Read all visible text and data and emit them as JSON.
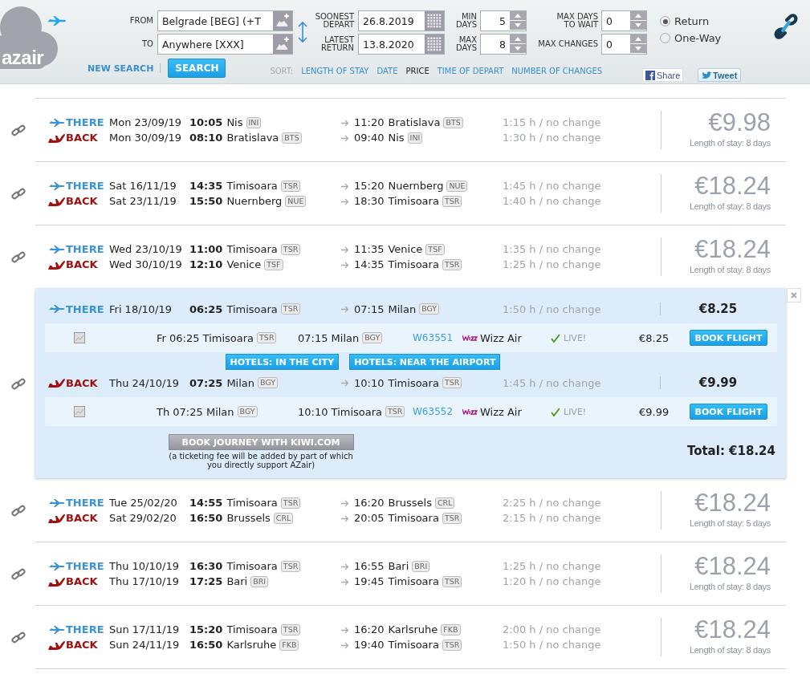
{
  "logo": {
    "text": "azair"
  },
  "search_form": {
    "from": {
      "label": "FROM",
      "value": "Belgrade [BEG] (+T"
    },
    "to": {
      "label": "TO",
      "value": "Anywhere [XXX]"
    },
    "soonest_depart": {
      "label": "SOONEST DEPART",
      "value": "26.8.2019"
    },
    "latest_return": {
      "label": "LATEST RETURN",
      "value": "13.8.2020"
    },
    "min_days": {
      "label": "MIN DAYS",
      "value": "5"
    },
    "max_days": {
      "label": "MAX DAYS",
      "value": "8"
    },
    "max_days_to_wait": {
      "label": "MAX DAYS TO WAIT",
      "value": "0"
    },
    "max_changes": {
      "label": "MAX CHANGES",
      "value": "0"
    },
    "trip_type": [
      {
        "label": "Return",
        "selected": true
      },
      {
        "label": "One-Way",
        "selected": false
      }
    ]
  },
  "actions": {
    "new_search": "NEW SEARCH",
    "search": "SEARCH"
  },
  "sort": {
    "label": "SORT:",
    "options": [
      {
        "label": "LENGTH OF STAY",
        "selected": false
      },
      {
        "label": "DATE",
        "selected": false
      },
      {
        "label": "PRICE",
        "selected": true
      },
      {
        "label": "TIME OF DEPART",
        "selected": false
      },
      {
        "label": "NUMBER OF CHANGES",
        "selected": false
      }
    ]
  },
  "social": {
    "share": "Share",
    "tweet": "Tweet"
  },
  "results": [
    {
      "kind": "summary",
      "price": "€9.98",
      "stay": "Length of stay: 8 days",
      "legs": [
        {
          "kind": "there",
          "label": "THERE",
          "date": "Mon 23/09/19",
          "time": "10:05",
          "city": "Nis",
          "code": "INI",
          "arrival_time": "11:20",
          "arrival_city": "Bratislava",
          "arrival_code": "BTS",
          "duration": "1:15 h / no change"
        },
        {
          "kind": "back",
          "label": "BACK",
          "date": "Mon 30/09/19",
          "time": "08:10",
          "city": "Bratislava",
          "code": "BTS",
          "arrival_time": "09:40",
          "arrival_city": "Nis",
          "arrival_code": "INI",
          "duration": "1:30 h / no change"
        }
      ]
    },
    {
      "kind": "summary",
      "price": "€18.24",
      "stay": "Length of stay: 8 days",
      "legs": [
        {
          "kind": "there",
          "label": "THERE",
          "date": "Sat 16/11/19",
          "time": "14:35",
          "city": "Timisoara",
          "code": "TSR",
          "arrival_time": "15:20",
          "arrival_city": "Nuernberg",
          "arrival_code": "NUE",
          "duration": "1:45 h / no change"
        },
        {
          "kind": "back",
          "label": "BACK",
          "date": "Sat 23/11/19",
          "time": "15:50",
          "city": "Nuernberg",
          "code": "NUE",
          "arrival_time": "18:30",
          "arrival_city": "Timisoara",
          "arrival_code": "TSR",
          "duration": "1:40 h / no change"
        }
      ]
    },
    {
      "kind": "summary",
      "price": "€18.24",
      "stay": "Length of stay: 8 days",
      "legs": [
        {
          "kind": "there",
          "label": "THERE",
          "date": "Wed 23/10/19",
          "time": "11:00",
          "city": "Timisoara",
          "code": "TSR",
          "arrival_time": "11:35",
          "arrival_city": "Venice",
          "arrival_code": "TSF",
          "duration": "1:35 h / no change"
        },
        {
          "kind": "back",
          "label": "BACK",
          "date": "Wed 30/10/19",
          "time": "12:10",
          "city": "Venice",
          "code": "TSF",
          "arrival_time": "14:35",
          "arrival_city": "Timisoara",
          "arrival_code": "TSR",
          "duration": "1:25 h / no change"
        }
      ]
    },
    {
      "kind": "detail",
      "hotels": [
        "HOTELS: IN THE CITY",
        "HOTELS: NEAR THE AIRPORT"
      ],
      "kiwi_button": "BOOK JOURNEY WITH KIWI.COM",
      "fee_note": "(a ticketing fee will be added by part of which you directly support AZair)",
      "total": "Total: €18.24",
      "legs": [
        {
          "kind": "there",
          "label": "THERE",
          "date": "Fri 18/10/19",
          "time": "06:25",
          "city": "Timisoara",
          "code": "TSR",
          "arrival_time": "07:15",
          "arrival_city": "Milan",
          "arrival_code": "BGY",
          "duration": "1:50 h / no change",
          "price": "€8.25",
          "segment": {
            "departure": "Fr 06:25 Timisoara",
            "departure_code": "TSR",
            "arrival": "07:15 Milan",
            "arrival_code": "BGY",
            "flight": "W63551",
            "airline": "Wizz Air",
            "status": "LIVE!",
            "price": "€8.25",
            "button": "BOOK FLIGHT"
          }
        },
        {
          "kind": "back",
          "label": "BACK",
          "date": "Thu 24/10/19",
          "time": "07:25",
          "city": "Milan",
          "code": "BGY",
          "arrival_time": "10:10",
          "arrival_city": "Timisoara",
          "arrival_code": "TSR",
          "duration": "1:45 h / no change",
          "price": "€9.99",
          "segment": {
            "departure": "Th 07:25 Milan",
            "departure_code": "BGY",
            "arrival": "10:10 Timisoara",
            "arrival_code": "TSR",
            "flight": "W63552",
            "airline": "Wizz Air",
            "status": "LIVE!",
            "price": "€9.99",
            "button": "BOOK FLIGHT"
          }
        }
      ]
    },
    {
      "kind": "summary",
      "price": "€18.24",
      "stay": "Length of stay: 5 days",
      "legs": [
        {
          "kind": "there",
          "label": "THERE",
          "date": "Tue 25/02/20",
          "time": "14:55",
          "city": "Timisoara",
          "code": "TSR",
          "arrival_time": "16:20",
          "arrival_city": "Brussels",
          "arrival_code": "CRL",
          "duration": "2:25 h / no change"
        },
        {
          "kind": "back",
          "label": "BACK",
          "date": "Sat 29/02/20",
          "time": "16:50",
          "city": "Brussels",
          "code": "CRL",
          "arrival_time": "20:05",
          "arrival_city": "Timisoara",
          "arrival_code": "TSR",
          "duration": "2:15 h / no change"
        }
      ]
    },
    {
      "kind": "summary",
      "price": "€18.24",
      "stay": "Length of stay: 8 days",
      "legs": [
        {
          "kind": "there",
          "label": "THERE",
          "date": "Thu 10/10/19",
          "time": "16:30",
          "city": "Timisoara",
          "code": "TSR",
          "arrival_time": "16:55",
          "arrival_city": "Bari",
          "arrival_code": "BRI",
          "duration": "1:25 h / no change"
        },
        {
          "kind": "back",
          "label": "BACK",
          "date": "Thu 17/10/19",
          "time": "17:25",
          "city": "Bari",
          "code": "BRI",
          "arrival_time": "19:45",
          "arrival_city": "Timisoara",
          "arrival_code": "TSR",
          "duration": "1:20 h / no change"
        }
      ]
    },
    {
      "kind": "summary",
      "price": "€18.24",
      "stay": "Length of stay: 8 days",
      "legs": [
        {
          "kind": "there",
          "label": "THERE",
          "date": "Sun 17/11/19",
          "time": "15:20",
          "city": "Timisoara",
          "code": "TSR",
          "arrival_time": "16:20",
          "arrival_city": "Karlsruhe",
          "arrival_code": "FKB",
          "duration": "2:00 h / no change"
        },
        {
          "kind": "back",
          "label": "BACK",
          "date": "Sun 24/11/19",
          "time": "16:50",
          "city": "Karlsruhe",
          "code": "FKB",
          "arrival_time": "19:40",
          "arrival_city": "Timisoara",
          "arrival_code": "TSR",
          "duration": "1:50 h / no change"
        }
      ]
    }
  ]
}
